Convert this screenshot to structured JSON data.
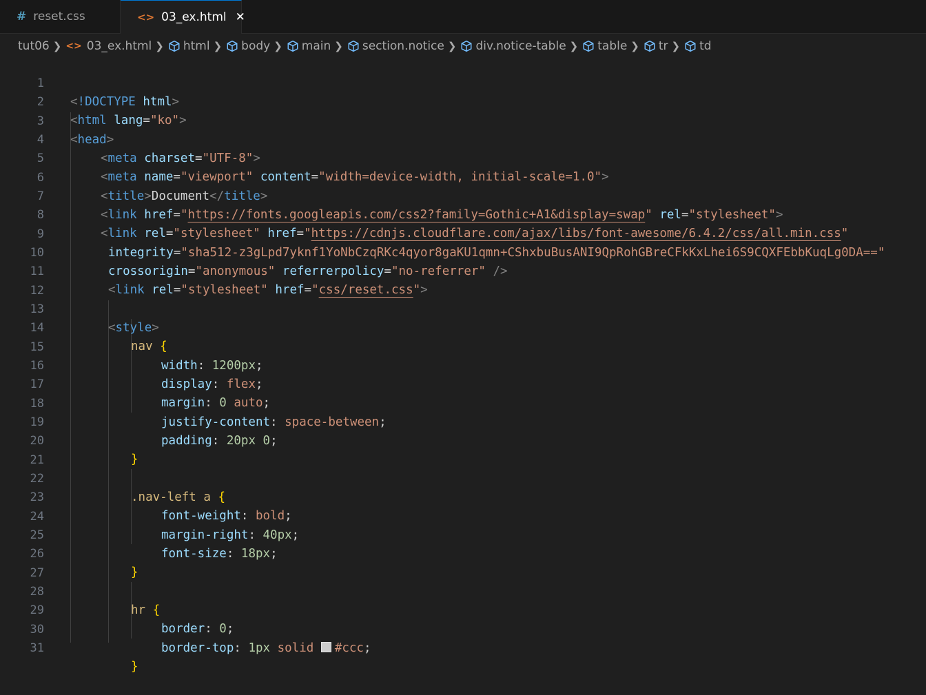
{
  "tabs": [
    {
      "icon": "#",
      "label": "reset.css",
      "active": false
    },
    {
      "icon": "<>",
      "label": "03_ex.html",
      "active": true,
      "close": "✕"
    }
  ],
  "breadcrumb": {
    "folder": "tut06",
    "file": "03_ex.html",
    "symbols": [
      "html",
      "body",
      "main",
      "section.notice",
      "div.notice-table",
      "table",
      "tr",
      "td"
    ]
  },
  "lines": [
    "1",
    "2",
    "3",
    "4",
    "5",
    "6",
    "7",
    "8",
    "9",
    "10",
    "11",
    "12",
    "13",
    "14",
    "15",
    "16",
    "17",
    "18",
    "19",
    "20",
    "21",
    "22",
    "23",
    "24",
    "25",
    "26",
    "27",
    "28",
    "29",
    "30",
    "31"
  ],
  "code": {
    "l1_doctype": "!DOCTYPE",
    "l1_html": "html",
    "l2_tag": "html",
    "l2_attr": "lang",
    "l2_val": "\"ko\"",
    "l3_tag": "head",
    "l4_tag": "meta",
    "l4_attr": "charset",
    "l4_val": "\"UTF-8\"",
    "l5_tag": "meta",
    "l5_attr1": "name",
    "l5_val1": "\"viewport\"",
    "l5_attr2": "content",
    "l5_val2": "\"width=device-width, initial-scale=1.0\"",
    "l6_tag": "title",
    "l6_text": "Document",
    "l7_tag": "link",
    "l7_attr1": "href",
    "l7_url": "https://fonts.googleapis.com/css2?family=Gothic+A1&display=swap",
    "l7_attr2": "rel",
    "l7_val2": "\"stylesheet\"",
    "l8_tag": "link",
    "l8_attr1": "rel",
    "l8_val1": "\"stylesheet\"",
    "l8_attr2": "href",
    "l8_url": "https://cdnjs.cloudflare.com/ajax/libs/font-awesome/6.4.2/css/all.min.css",
    "l9_attr": "integrity",
    "l9_val": "\"sha512-z3gLpd7yknf1YoNbCzqRKc4qyor8gaKU1qmn+CShxbuBusANI9QpRohGBreCFkKxLhei6S9CQXFEbbKuqLg0DA==\"",
    "l10_attr1": "crossorigin",
    "l10_val1": "\"anonymous\"",
    "l10_attr2": "referrerpolicy",
    "l10_val2": "\"no-referrer\"",
    "l11_tag": "link",
    "l11_attr1": "rel",
    "l11_val1": "\"stylesheet\"",
    "l11_attr2": "href",
    "l11_url": "css/reset.css",
    "l13_tag": "style",
    "l14_sel": "nav",
    "l15_prop": "width",
    "l15_val": "1200px",
    "l16_prop": "display",
    "l16_val": "flex",
    "l17_prop": "margin",
    "l17_num": "0",
    "l17_val": "auto",
    "l18_prop": "justify-content",
    "l18_val": "space-between",
    "l19_prop": "padding",
    "l19_num1": "20px",
    "l19_num2": "0",
    "l22_sel": ".nav-left a",
    "l23_prop": "font-weight",
    "l23_val": "bold",
    "l24_prop": "margin-right",
    "l24_val": "40px",
    "l25_prop": "font-size",
    "l25_val": "18px",
    "l28_sel": "hr",
    "l29_prop": "border",
    "l29_val": "0",
    "l30_prop": "border-top",
    "l30_num": "1px",
    "l30_val": "solid",
    "l30_color": "#ccc"
  },
  "colors": {
    "background": "#1f1f1f",
    "tag": "#569cd6",
    "attribute": "#9cdcfe",
    "string": "#ce9178",
    "selector": "#d7ba7d",
    "number": "#b5cea8",
    "bracket": "#ffd700",
    "active_tab_accent": "#0078d4",
    "swatch": "#cccccc"
  }
}
